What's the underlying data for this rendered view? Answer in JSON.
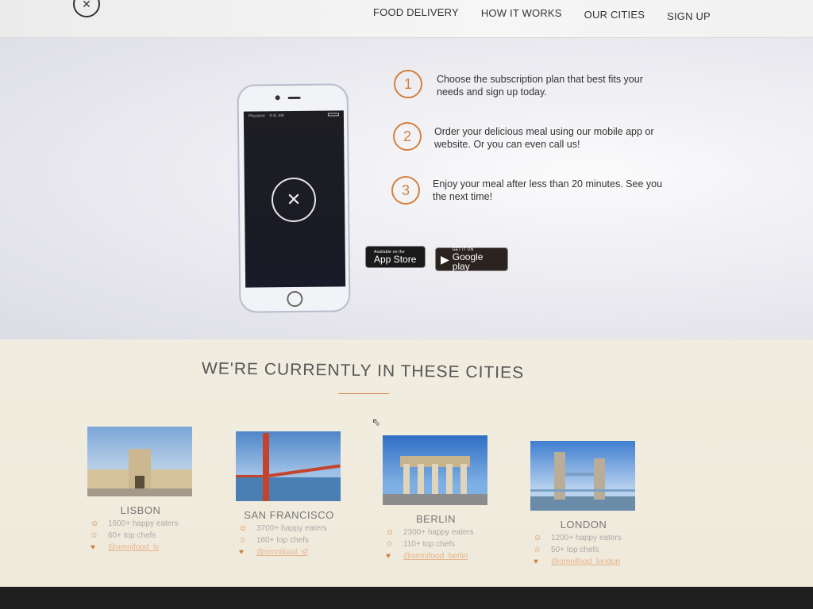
{
  "nav": {
    "logo_icon": "fork-knife-logo-icon",
    "links": [
      "FOOD DELIVERY",
      "HOW IT WORKS",
      "OUR CITIES",
      "SIGN UP"
    ]
  },
  "steps": [
    {
      "number": "1",
      "text": "Choose the subscription plan that best fits your needs and sign up today."
    },
    {
      "number": "2",
      "text": "Order your delicious meal using our mobile app or website. Or you can even call us!"
    },
    {
      "number": "3",
      "text": "Enjoy your meal after less than 20 minutes. See you the next time!"
    }
  ],
  "phone": {
    "status_left": "Playstore",
    "status_time": "9:41 AM",
    "app_logo_icon": "fork-knife-logo-icon"
  },
  "store_buttons": {
    "apple_small": "Available on the",
    "apple_big": "App Store",
    "google_small": "GET IT ON",
    "google_big": "Google play"
  },
  "cities_section": {
    "title": "WE'RE CURRENTLY IN THESE CITIES"
  },
  "cities": [
    {
      "name": "LISBON",
      "eaters": "1600+ happy eaters",
      "chefs": "60+ top chefs",
      "twitter": "@omnifood_lx"
    },
    {
      "name": "SAN FRANCISCO",
      "eaters": "3700+ happy eaters",
      "chefs": "160+ top chefs",
      "twitter": "@omnifood_sf"
    },
    {
      "name": "BERLIN",
      "eaters": "2300+ happy eaters",
      "chefs": "110+ top chefs",
      "twitter": "@omnifood_berlin"
    },
    {
      "name": "LONDON",
      "eaters": "1200+ happy eaters",
      "chefs": "50+ top chefs",
      "twitter": "@omnifood_london"
    }
  ],
  "colors": {
    "accent": "#d2813f",
    "link": "#e7b48c"
  }
}
